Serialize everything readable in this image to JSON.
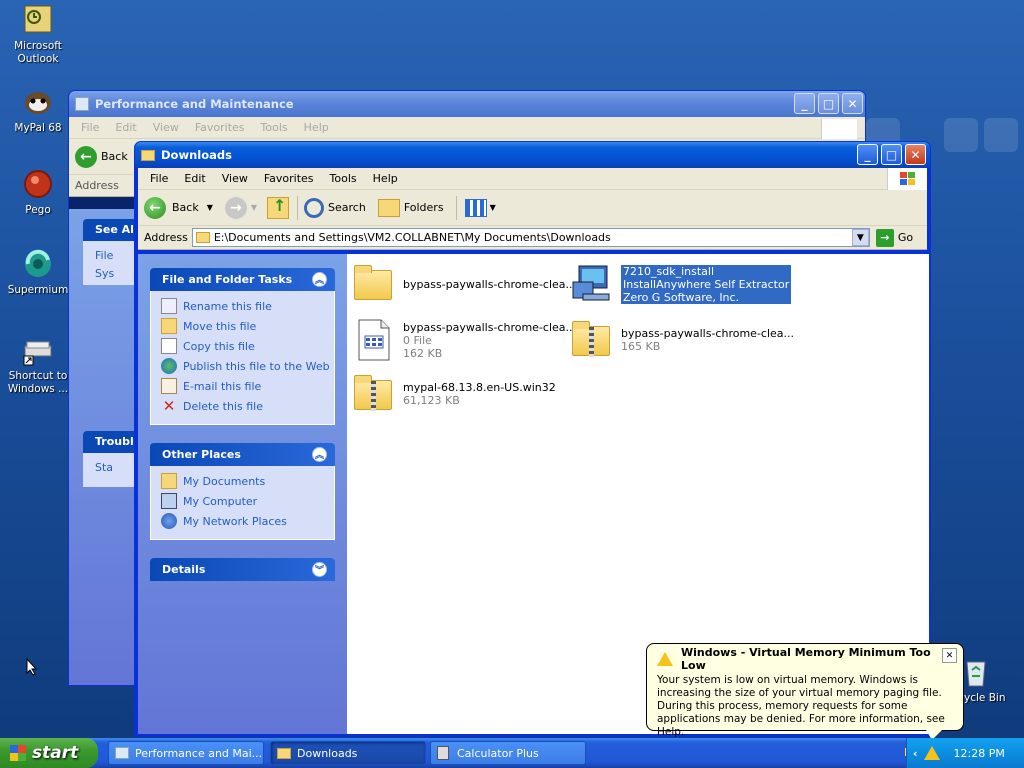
{
  "desktop": {
    "icons": [
      {
        "label": "Microsoft Outlook",
        "icon": "outlook-icon"
      },
      {
        "label": "MyPal 68",
        "icon": "mypal-icon"
      },
      {
        "label": "Pego",
        "icon": "pego-icon"
      },
      {
        "label": "Supermium",
        "icon": "supermium-icon"
      },
      {
        "label": "Shortcut to Windows ...",
        "icon": "shortcut-icon"
      },
      {
        "label": "ycle Bin",
        "icon": "recycle-bin-icon"
      }
    ]
  },
  "bg_window": {
    "title": "Performance and Maintenance",
    "menu": [
      "File",
      "Edit",
      "View",
      "Favorites",
      "Tools",
      "Help"
    ],
    "back_label": "Back",
    "address_label": "Address",
    "panels": [
      {
        "title": "See Al",
        "items": [
          "File",
          "Sys"
        ]
      },
      {
        "title": "Troubl",
        "items": [
          "Sta"
        ]
      }
    ]
  },
  "window": {
    "title": "Downloads",
    "menu": [
      "File",
      "Edit",
      "View",
      "Favorites",
      "Tools",
      "Help"
    ],
    "toolbar": {
      "back": "Back",
      "search": "Search",
      "folders": "Folders"
    },
    "address_label": "Address",
    "address_value": "E:\\Documents and Settings\\VM2.COLLABNET\\My Documents\\Downloads",
    "go_label": "Go",
    "tasks_panel": {
      "title": "File and Folder Tasks",
      "items": [
        "Rename this file",
        "Move this file",
        "Copy this file",
        "Publish this file to the Web",
        "E-mail this file",
        "Delete this file"
      ]
    },
    "places_panel": {
      "title": "Other Places",
      "items": [
        "My Documents",
        "My Computer",
        "My Network Places"
      ]
    },
    "details_panel": {
      "title": "Details"
    },
    "files": [
      {
        "name": "bypass-paywalls-chrome-clea...",
        "line2": "",
        "line3": "",
        "type": "folder"
      },
      {
        "name": "7210_sdk_install",
        "line2": "InstallAnywhere Self Extractor",
        "line3": "Zero G Software, Inc.",
        "type": "installer",
        "selected": true
      },
      {
        "name": "bypass-paywalls-chrome-clea...",
        "line2": "0 File",
        "line3": "162 KB",
        "type": "document"
      },
      {
        "name": "bypass-paywalls-chrome-clea...",
        "line2": "165 KB",
        "line3": "",
        "type": "zip"
      },
      {
        "name": "mypal-68.13.8.en-US.win32",
        "line2": "61,123 KB",
        "line3": "",
        "type": "zip"
      }
    ]
  },
  "balloon": {
    "title": "Windows - Virtual Memory Minimum Too Low",
    "body": "Your system is low on virtual memory. Windows is increasing the size of your virtual memory paging file. During this process, memory requests for some applications may be denied. For more information, see Help."
  },
  "taskbar": {
    "start": "start",
    "buttons": [
      "Performance and Mai...",
      "Downloads",
      "Calculator Plus"
    ],
    "active_index": 1,
    "clock": "12:28 PM"
  }
}
